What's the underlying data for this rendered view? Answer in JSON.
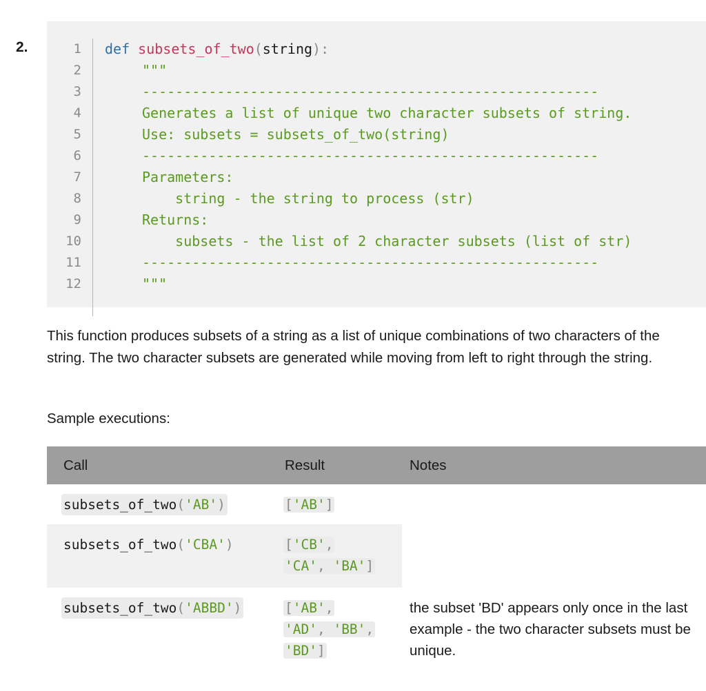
{
  "item_number": "2.",
  "code": {
    "line_numbers": [
      "1",
      "2",
      "3",
      "4",
      "5",
      "6",
      "7",
      "8",
      "9",
      "10",
      "11",
      "12"
    ],
    "def_keyword": "def",
    "function_name": "subsets_of_two",
    "paren_open": "(",
    "param": "string",
    "paren_close": "):",
    "doc_lines": [
      "\"\"\"",
      "-------------------------------------------------------",
      "Generates a list of unique two character subsets of string.",
      "Use: subsets = subsets_of_two(string)",
      "-------------------------------------------------------",
      "Parameters:",
      "    string - the string to process (str)",
      "Returns:",
      "    subsets - the list of 2 character subsets (list of str)",
      "-------------------------------------------------------",
      "\"\"\""
    ]
  },
  "description": "This function produces subsets of a string as a list of unique combinations of two characters of the string. The two character subsets are generated while moving from left to right through the string.",
  "sample_heading": "Sample executions:",
  "table": {
    "headers": [
      "Call",
      "Result",
      "Notes"
    ],
    "rows": [
      {
        "call": {
          "fn": "subsets_of_two",
          "open": "(",
          "arg": "'AB'",
          "close": ")"
        },
        "result_lines": [
          [
            "[",
            "'AB'",
            "]"
          ]
        ],
        "notes": ""
      },
      {
        "call": {
          "fn": "subsets_of_two",
          "open": "(",
          "arg": "'CBA'",
          "close": ")"
        },
        "result_lines": [
          [
            "[",
            "'CB'",
            ","
          ],
          [
            "",
            "'CA'",
            ", "
          ],
          [
            "",
            "'BA'",
            "]"
          ]
        ],
        "notes": ""
      },
      {
        "call": {
          "fn": "subsets_of_two",
          "open": "(",
          "arg": "'ABBD'",
          "close": ")"
        },
        "result_lines": [
          [
            "[",
            "'AB'",
            ","
          ],
          [
            "",
            "'AD'",
            ", "
          ],
          [
            "",
            "'BB'",
            ","
          ],
          [
            "",
            "'BD'",
            "]"
          ]
        ],
        "notes": "the subset 'BD' appears only once in the last example - the two character subsets must be unique."
      }
    ]
  },
  "colors": {
    "keyword": "#2f6fa7",
    "function": "#c2375b",
    "string": "#5a9a20",
    "header_bg": "#9e9e9e",
    "code_bg": "#f1f1f1"
  }
}
